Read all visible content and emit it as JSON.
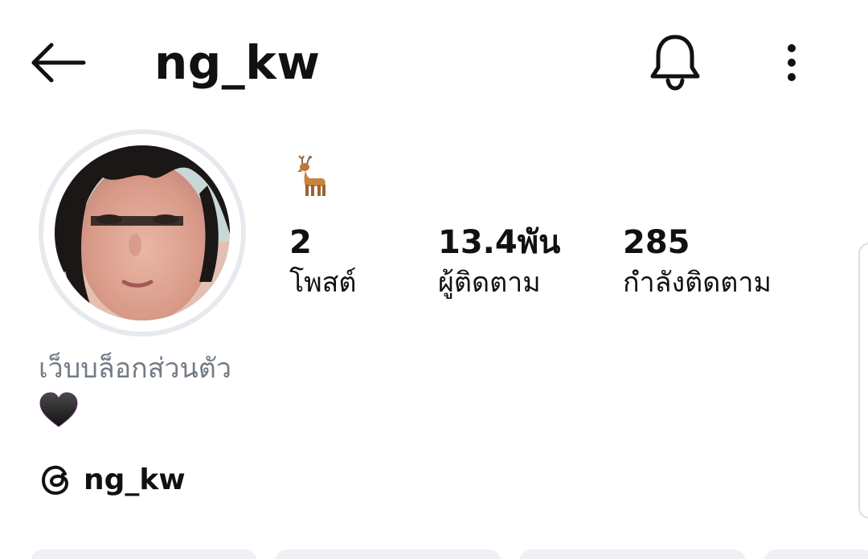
{
  "header": {
    "username": "ng_kw",
    "back_icon": "arrow-left-icon",
    "bell_icon": "bell-icon",
    "more_icon": "more-vertical-icon"
  },
  "profile": {
    "avatar_icon": "profile-photo",
    "bio_emoji": "🦌",
    "stats": [
      {
        "value": "2",
        "label": "โพสต์"
      },
      {
        "value": "13.4พัน",
        "label": "ผู้ติดตาม"
      },
      {
        "value": "285",
        "label": "กำลังติดตาม"
      }
    ],
    "category": "เว็บบล็อกส่วนตัว",
    "bio_heart": "🖤",
    "threads": {
      "icon": "threads-icon",
      "name": "ng_kw"
    }
  },
  "colors": {
    "text": "#111111",
    "muted": "#737b86",
    "ring": "#e6e9ee",
    "button_bg": "#eef0f3"
  }
}
